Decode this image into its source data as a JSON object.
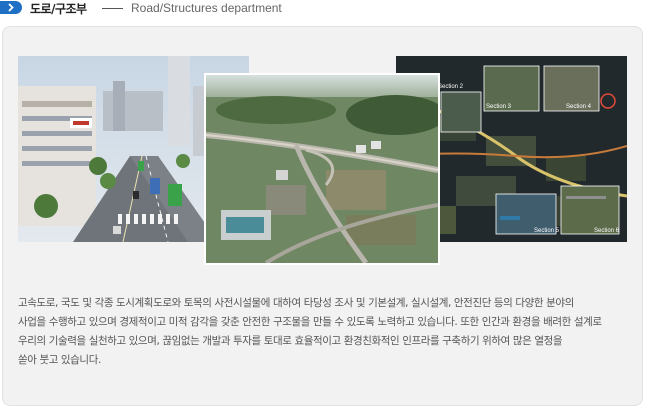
{
  "header": {
    "title": "도로/구조부",
    "subtitle": "Road/Structures department",
    "arrow_icon": "chevron-right-icon",
    "accent_color": "#1f6fc4"
  },
  "images": {
    "city": "city-street-photo",
    "aerial": "aerial-interchange-photo",
    "sections": "road-sections-visualization"
  },
  "sections_overlay": {
    "labels": [
      "Section 2",
      "Section 3",
      "Section 4",
      "Section 5",
      "Section 6"
    ]
  },
  "description": "고속도로, 국도 및 각종 도시계획도로와 토목의 사전시설물에 대하여 타당성 조사 및 기본설계, 실시설계, 안전진단 등의 다양한 분야의\n사업을 수행하고 있으며 경제적이고 미적 감각을 갖춘 안전한 구조물을 만들 수 있도록 노력하고 있습니다. 또한 인간과 환경을 배려한 설계로\n우리의 기술력을 실천하고 있으며, 끊임없는 개발과 투자를 토대로 효율적이고 환경친화적인 인프라를 구축하기 위하여 많은 열정을\n쏟아 붓고 있습니다."
}
